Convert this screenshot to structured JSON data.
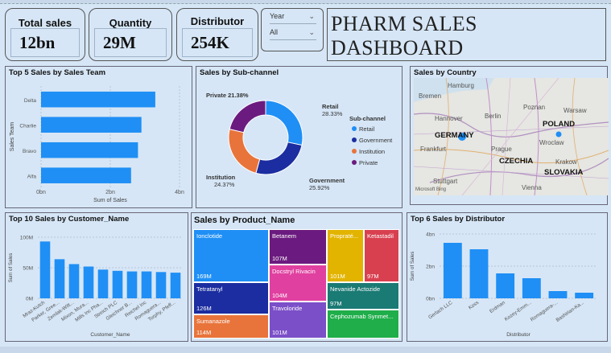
{
  "dashboard_title": "PHARM SALES DASHBOARD",
  "kpis": {
    "total_sales": {
      "label": "Total sales",
      "value": "12bn"
    },
    "quantity": {
      "label": "Quantity",
      "value": "29M"
    },
    "distributor": {
      "label": "Distributor",
      "value": "254K"
    }
  },
  "slicer": {
    "field": "Year",
    "value": "All"
  },
  "panels": {
    "sales_team": "Top 5 Sales by Sales Team",
    "subchannel": "Sales by Sub-channel",
    "country": "Sales by Country",
    "customer": "Top 10 Sales by Customer_Name",
    "product": "Sales by Product_Name",
    "distributor": "Top 6 Sales by Distributor"
  },
  "colors": {
    "bar": "#1f8ff5",
    "retail": "#1f8ff5",
    "government": "#1b2da0",
    "institution": "#e8743b",
    "private": "#6b1b7f"
  },
  "chart_data": [
    {
      "type": "bar",
      "orientation": "horizontal",
      "categories": [
        "Delta",
        "Charlie",
        "Bravo",
        "Alfa"
      ],
      "values": [
        3.3,
        2.9,
        2.8,
        2.6
      ],
      "xlabel": "Sum of Sales",
      "ylabel": "Sales Team",
      "xticks": [
        "0bn",
        "2bn",
        "4bn"
      ],
      "xlim": [
        0,
        4
      ]
    },
    {
      "type": "pie",
      "donut": true,
      "legend_title": "Sub-channel",
      "legend": [
        "Retail",
        "Government",
        "Institution",
        "Private"
      ],
      "slices": [
        {
          "name": "Retail",
          "value": 28.33,
          "label": "Retail",
          "pct": "28.33%"
        },
        {
          "name": "Government",
          "value": 25.92,
          "label": "Government",
          "pct": "25.92%"
        },
        {
          "name": "Institution",
          "value": 24.37,
          "label": "Institution",
          "pct": "24.37%"
        },
        {
          "name": "Private",
          "value": 21.38,
          "label": "Private",
          "pct": "21.38%"
        }
      ]
    },
    {
      "type": "bar",
      "categories": [
        "Mraz-Kutch",
        "Parker, Gree...",
        "Zemlak-Witt...",
        "Mixon, Mura...",
        "Mills Inc Pha...",
        "Streich PLC",
        "Gleichner B...",
        "Reichel Inc",
        "Romaguera...",
        "Torphy, Pfeff..."
      ],
      "values": [
        93,
        64,
        56,
        52,
        47,
        45,
        44,
        44,
        43,
        42
      ],
      "xlabel": "Customer_Name",
      "ylabel": "Sum of Sales",
      "yticks": [
        "0M",
        "50M",
        "100M"
      ],
      "ylim": [
        0,
        100
      ]
    },
    {
      "type": "bar",
      "categories": [
        "Gerlach LLC",
        "Koss",
        "Erdman",
        "Kozey-Emm...",
        "Romaguera-...",
        "Bashirian-Ka..."
      ],
      "values": [
        3.45,
        3.05,
        1.55,
        1.25,
        0.45,
        0.35
      ],
      "xlabel": "Distributor",
      "ylabel": "Sum of Sales",
      "yticks": [
        "0bn",
        "2bn",
        "4bn"
      ],
      "ylim": [
        0,
        4
      ]
    },
    {
      "type": "treemap",
      "items": [
        {
          "name": "Ionclotide",
          "value": "169M",
          "color": "#1f8ff5"
        },
        {
          "name": "Tetratanyl",
          "value": "126M",
          "color": "#1b2da0"
        },
        {
          "name": "Sumanazole",
          "value": "114M",
          "color": "#e8743b"
        },
        {
          "name": "Betanem",
          "value": "107M",
          "color": "#6b1b7f"
        },
        {
          "name": "Docstryl Rivacin",
          "value": "104M",
          "color": "#e040a0"
        },
        {
          "name": "Travoloride",
          "value": "101M",
          "color": "#7b4fc8"
        },
        {
          "name": "Propraté...",
          "value": "101M",
          "color": "#e2b400"
        },
        {
          "name": "Ketastadil",
          "value": "97M",
          "color": "#d84050"
        },
        {
          "name": "Nevanide Actozide",
          "value": "97M",
          "color": "#1a7a74"
        },
        {
          "name": "Cephozumab Synmet...",
          "value": "",
          "color": "#1fae4a"
        }
      ]
    }
  ],
  "map": {
    "cities": [
      "Hamburg",
      "Bremen",
      "Hannover",
      "Berlin",
      "Poznan",
      "Warsaw",
      "Frankfurt",
      "Prague",
      "Wroclaw",
      "Krakow",
      "Stuttgart",
      "Vienna"
    ],
    "countries": [
      "GERMANY",
      "POLAND",
      "CZECHIA",
      "SLOVAKIA"
    ],
    "attribution": "Microsoft Bing"
  }
}
